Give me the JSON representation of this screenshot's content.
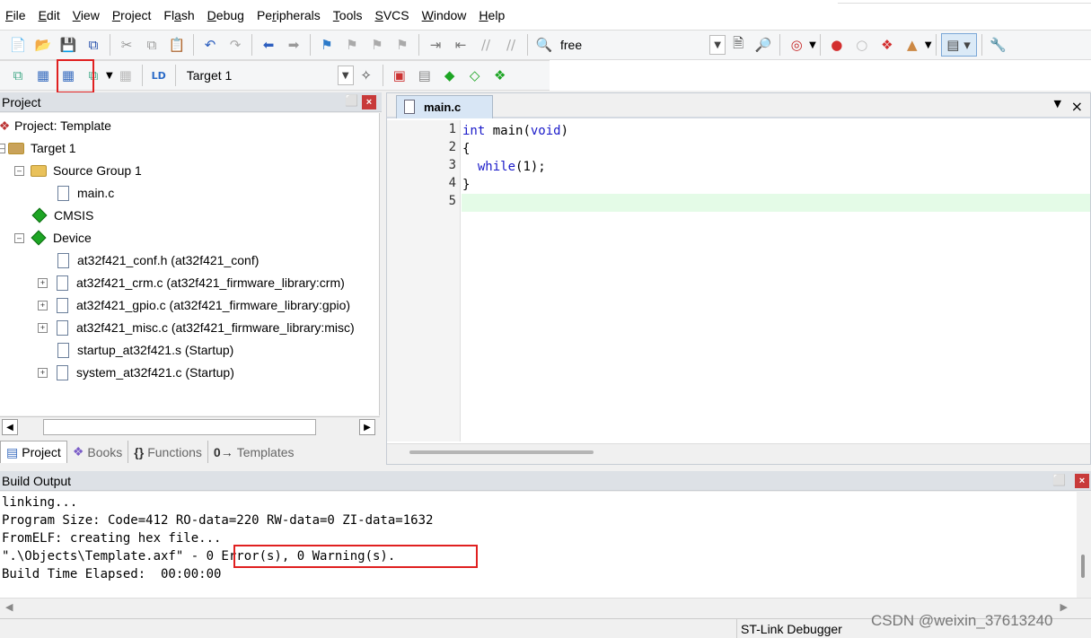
{
  "menu": [
    "File",
    "Edit",
    "View",
    "Project",
    "Flash",
    "Debug",
    "Peripherals",
    "Tools",
    "SVCS",
    "Window",
    "Help"
  ],
  "menu_underline": [
    "F",
    "E",
    "V",
    "P",
    "a",
    "D",
    "r",
    "T",
    "S",
    "W",
    "H"
  ],
  "toolbar1": {
    "config_label": "free"
  },
  "toolbar2": {
    "target_select": "Target 1"
  },
  "project_panel": {
    "title": "Project",
    "tree": [
      {
        "label": "Project: Template"
      },
      {
        "label": "Target 1"
      },
      {
        "label": "Source Group 1"
      },
      {
        "label": "main.c"
      },
      {
        "label": "CMSIS"
      },
      {
        "label": "Device"
      },
      {
        "label": "at32f421_conf.h (at32f421_conf)"
      },
      {
        "label": "at32f421_crm.c (at32f421_firmware_library:crm)"
      },
      {
        "label": "at32f421_gpio.c (at32f421_firmware_library:gpio)"
      },
      {
        "label": "at32f421_misc.c (at32f421_firmware_library:misc)"
      },
      {
        "label": "startup_at32f421.s (Startup)"
      },
      {
        "label": "system_at32f421.c (Startup)"
      }
    ],
    "tabs": [
      "Project",
      "Books",
      "Functions",
      "Templates"
    ]
  },
  "editor": {
    "tab_label": "main.c",
    "line_numbers": [
      "1",
      "2",
      "3",
      "4",
      "5"
    ],
    "code": {
      "l1_kw": "int",
      "l1_fn": " main(",
      "l1_kw2": "void",
      "l1_end": ")",
      "l2": "{",
      "l3_indent": "  ",
      "l3_kw": "while",
      "l3_rest": "(1);",
      "l4": "}",
      "l5": ""
    }
  },
  "build_output": {
    "title": "Build Output",
    "lines": [
      "linking...",
      "Program Size: Code=412 RO-data=220 RW-data=0 ZI-data=1632",
      "FromELF: creating hex file...",
      "\".\\Objects\\Template.axf\" - 0 Error(s), 0 Warning(s).",
      "Build Time Elapsed:  00:00:00"
    ]
  },
  "status": {
    "debugger": "ST-Link Debugger"
  },
  "watermark": "CSDN @weixin_37613240",
  "colors": {
    "highlight_box": "#e02020",
    "keyword": "#1a1ac9",
    "current_line": "#e4fbe7"
  }
}
